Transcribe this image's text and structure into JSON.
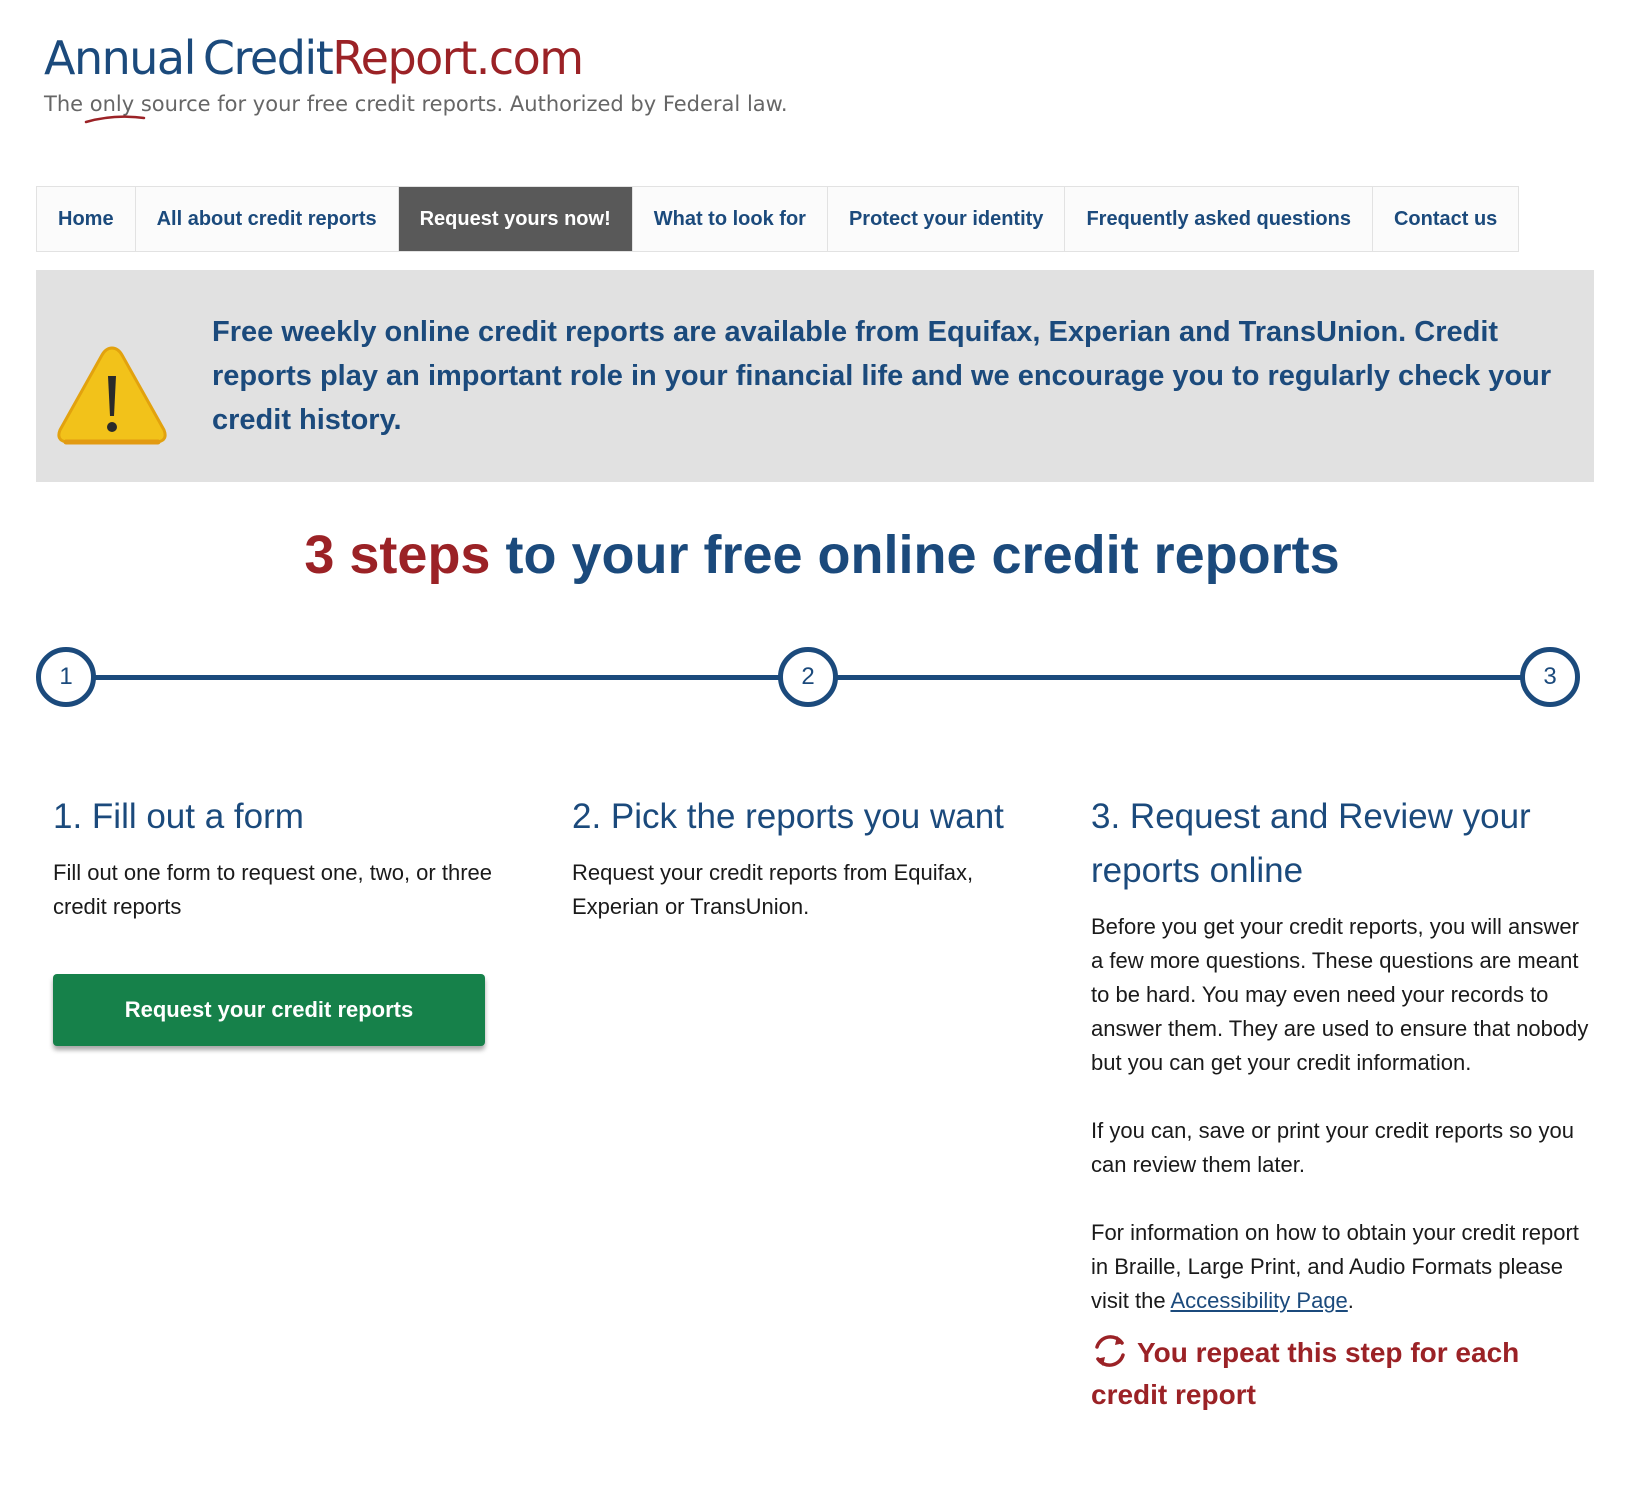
{
  "logo": {
    "part1": "Annual",
    "part2": "Credit",
    "part3": "Report.com"
  },
  "tagline": {
    "before": "The ",
    "emphasis": "only",
    "after": " source for your free credit reports. Authorized by Federal law."
  },
  "nav": {
    "items": [
      {
        "label": "Home"
      },
      {
        "label": "All about credit reports"
      },
      {
        "label": "Request yours now!"
      },
      {
        "label": "What to look for"
      },
      {
        "label": "Protect your identity"
      },
      {
        "label": "Frequently asked questions"
      },
      {
        "label": "Contact us"
      }
    ],
    "active": "Request yours now!"
  },
  "alert": {
    "icon": "warning-icon",
    "text": "Free weekly online credit reports are available from Equifax, Experian and TransUnion. Credit reports play an important role in your financial life and we encourage you to regularly check your credit history."
  },
  "steps_title": {
    "accent": "3 steps",
    "rest": " to your free online credit reports"
  },
  "timeline": [
    "1",
    "2",
    "3"
  ],
  "steps": {
    "step1": {
      "heading": "1. Fill out a form",
      "body": "Fill out one form to request one, two, or three credit reports",
      "button": "Request your credit reports"
    },
    "step2": {
      "heading": "2. Pick the reports you want",
      "body": "Request your credit reports from Equifax, Experian or TransUnion."
    },
    "step3": {
      "heading": "3. Request and Review your reports online",
      "p1": "Before you get your credit reports, you will answer a few more questions. These questions are meant to be hard. You may even need your records to answer them. They are used to ensure that nobody but you can get your credit information.",
      "p2": "If you can, save or print your credit reports so you can review them later.",
      "p3_before": "For information on how to obtain your credit report in Braille, Large Print, and Audio Formats please visit the ",
      "p3_link": "Accessibility Page",
      "p3_after": ".",
      "repeat_text": "You repeat this step for each credit report",
      "repeat_icon": "refresh-icon"
    }
  },
  "colors": {
    "brand_blue": "#1b4a7c",
    "brand_red": "#9b2226",
    "cta_green": "#16814a",
    "nav_active": "#595959",
    "alert_bg": "#e1e1e1"
  }
}
